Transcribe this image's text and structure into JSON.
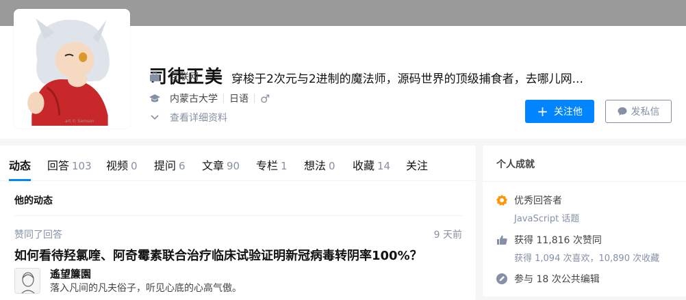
{
  "profile": {
    "name": "司徒正美",
    "headline": "穿梭于2次元与2进制的魔法师，源码世界的顶级捕食者，去哪儿网...",
    "industry": "互联网",
    "school": "内蒙古大学",
    "major": "日语",
    "gender_symbol": "♂",
    "detail_link": "查看详细资料",
    "follow_label": "关注他",
    "message_label": "发私信"
  },
  "tabs": [
    {
      "label": "动态",
      "count": ""
    },
    {
      "label": "回答",
      "count": "103"
    },
    {
      "label": "视频",
      "count": "0"
    },
    {
      "label": "提问",
      "count": "6"
    },
    {
      "label": "文章",
      "count": "90"
    },
    {
      "label": "专栏",
      "count": "1"
    },
    {
      "label": "想法",
      "count": "0"
    },
    {
      "label": "收藏",
      "count": "14"
    },
    {
      "label": "关注",
      "count": ""
    }
  ],
  "feed": {
    "section_title": "他的动态",
    "action": "赞同了回答",
    "time": "9 天前",
    "question": "如何看待羟氯喹、阿奇霉素联合治疗临床试验证明新冠病毒转阴率100%？",
    "answerer_name": "遙望簾園",
    "answerer_bio": "落入凡间的凡夫俗子，听见心底的心高气傲。"
  },
  "achievements": {
    "title": "个人成就",
    "excellent": "优秀回答者",
    "excellent_topic": "JavaScript 话题",
    "upvotes": "获得 11,816 次赞同",
    "likes_collects": "获得 1,094 次喜欢，10,890 次收藏",
    "edits": "参与 18 次公共编辑"
  },
  "colors": {
    "accent": "#0084ff",
    "muted": "#8590a6",
    "badge": "#ff9607"
  },
  "icons": {
    "industry": "briefcase-icon",
    "education": "graduation-cap-icon",
    "detail": "chevron-down-icon",
    "follow": "plus-icon",
    "message": "chat-bubble-icon",
    "excellent": "badge-icon",
    "upvote": "thumbs-up-icon",
    "edit": "pencil-icon"
  }
}
